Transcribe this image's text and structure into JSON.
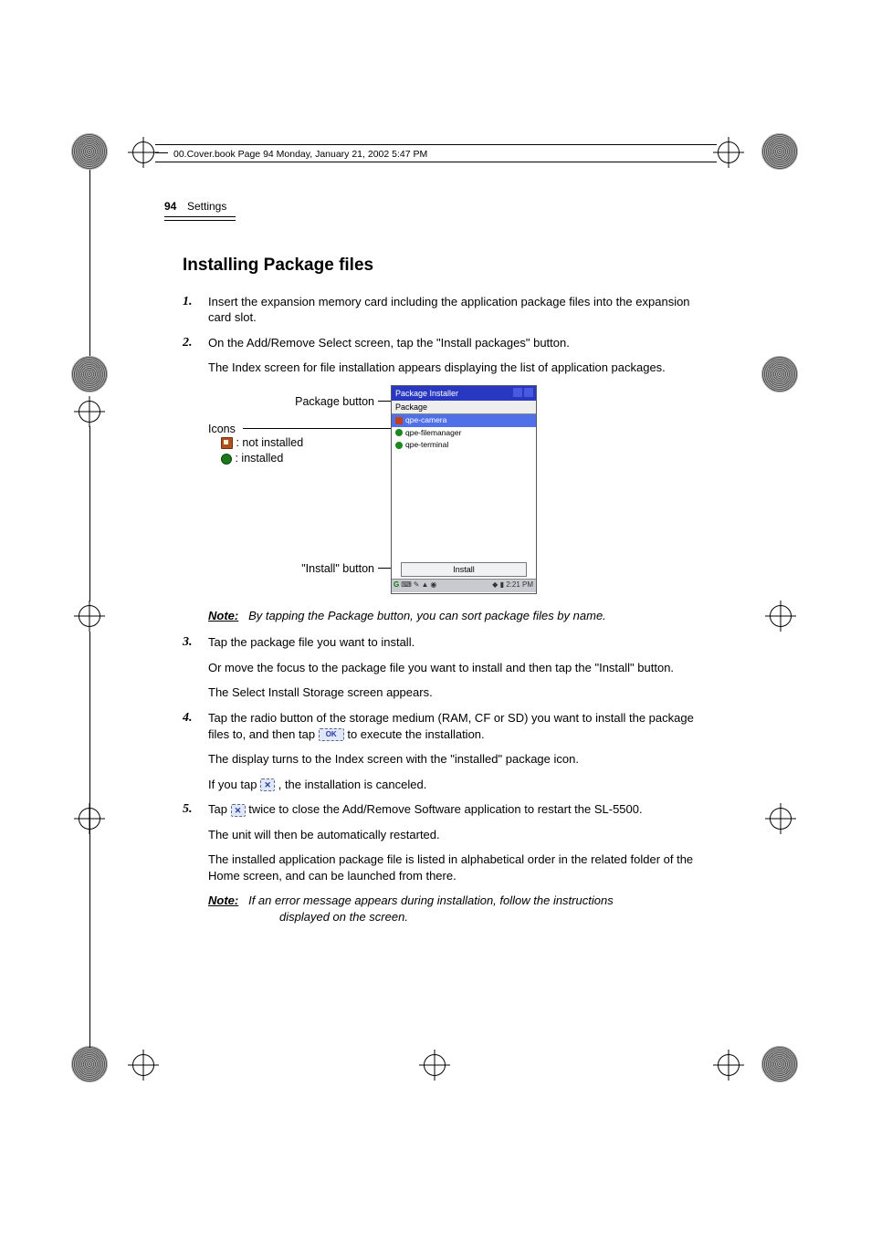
{
  "meta_line": "00.Cover.book  Page 94  Monday, January 21, 2002  5:47 PM",
  "header": {
    "page_num": "94",
    "section": "Settings"
  },
  "title": "Installing Package files",
  "steps": {
    "s1": {
      "num": "1.",
      "p1": "Insert the expansion memory card including the application package files into the expansion card slot."
    },
    "s2": {
      "num": "2.",
      "p1": "On the Add/Remove Select screen, tap the \"Install packages\" button.",
      "p2": "The Index screen for file installation appears displaying the list of application packages."
    },
    "s3": {
      "num": "3.",
      "p1": "Tap the package file you want to install.",
      "p2": "Or move the focus to the package file you want to install and then tap the \"Install\" button.",
      "p3": "The Select Install Storage screen appears."
    },
    "s4": {
      "num": "4.",
      "p1a": "Tap the radio button of the storage medium (RAM, CF or SD) you want to install the package files to, and then tap ",
      "p1b": " to execute the installation.",
      "p2": "The display turns to the Index screen with the \"installed\" package icon.",
      "p3a": "If you tap ",
      "p3b": ", the installation is canceled."
    },
    "s5": {
      "num": "5.",
      "p1a": "Tap ",
      "p1b": " twice to close the Add/Remove Software application to restart the SL-5500.",
      "p2": "The unit will then be automatically restarted.",
      "p3": "The installed application package file is listed in alphabetical order in the related folder of the Home screen, and can be launched from there."
    }
  },
  "callouts": {
    "package_button": "Package button",
    "icons_label": "Icons",
    "not_installed": ": not installed",
    "installed": ": installed",
    "install_button": "\"Install\" button"
  },
  "screenshot": {
    "title": "Package Installer",
    "col": "Package",
    "rows": {
      "r1": "qpe-camera",
      "r2": "qpe-filemanager",
      "r3": "qpe-terminal"
    },
    "install_btn": "Install",
    "clock": "2:21 PM"
  },
  "icons": {
    "ok": "OK",
    "x": "✕",
    "g": "G"
  },
  "note1": {
    "label": "Note:",
    "text": "By tapping the Package button, you can sort package files by name."
  },
  "note2": {
    "label": "Note:",
    "text_l1": "If an error message appears during installation, follow the instructions",
    "text_l2": "displayed on the screen."
  }
}
